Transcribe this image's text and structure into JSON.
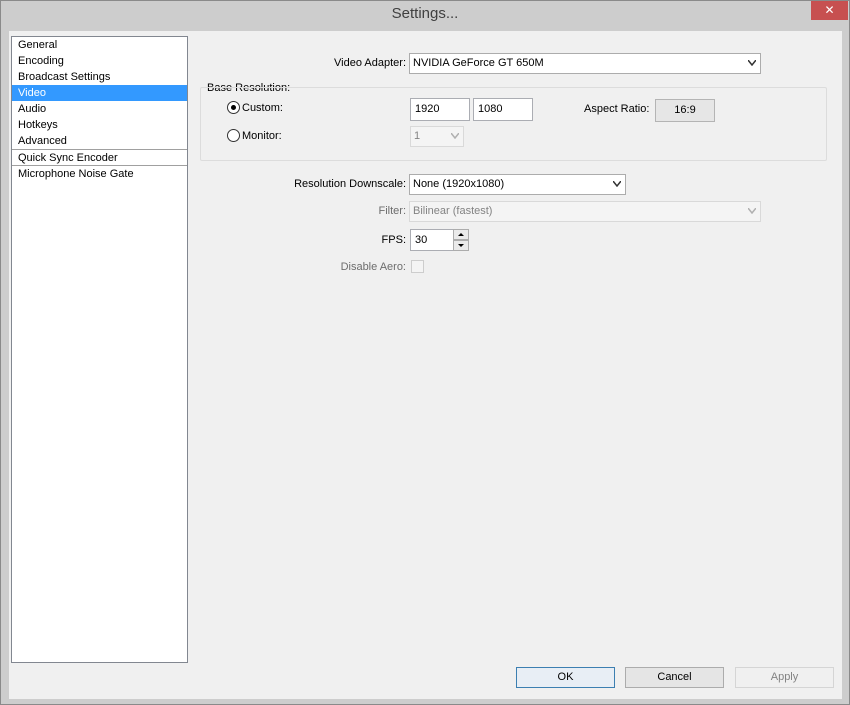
{
  "window": {
    "title": "Settings...",
    "close_glyph": "✕"
  },
  "sidebar": {
    "items": [
      {
        "label": "General"
      },
      {
        "label": "Encoding"
      },
      {
        "label": "Broadcast Settings"
      },
      {
        "label": "Video"
      },
      {
        "label": "Audio"
      },
      {
        "label": "Hotkeys"
      },
      {
        "label": "Advanced"
      },
      {
        "label": "Quick Sync Encoder"
      },
      {
        "label": "Microphone Noise Gate"
      }
    ],
    "selected": "Video"
  },
  "video": {
    "adapter_label": "Video Adapter:",
    "adapter_value": "NVIDIA GeForce GT 650M",
    "base_resolution_label": "Base Resolution:",
    "custom_label": "Custom:",
    "custom_width": "1920",
    "custom_height": "1080",
    "aspect_label": "Aspect Ratio:",
    "aspect_value": "16:9",
    "monitor_label": "Monitor:",
    "monitor_value": "1",
    "downscale_label": "Resolution Downscale:",
    "downscale_value": "None  (1920x1080)",
    "filter_label": "Filter:",
    "filter_value": "Bilinear (fastest)",
    "fps_label": "FPS:",
    "fps_value": "30",
    "disable_aero_label": "Disable Aero:"
  },
  "buttons": {
    "ok": "OK",
    "cancel": "Cancel",
    "apply": "Apply"
  },
  "icons": {
    "dropdown": "chevron-down-icon",
    "spin_up": "arrow-up-icon",
    "spin_down": "arrow-down-icon",
    "close": "close-icon"
  },
  "colors": {
    "selection": "#3399ff",
    "close_button": "#c75050",
    "title_bar": "#cdcdcd"
  }
}
